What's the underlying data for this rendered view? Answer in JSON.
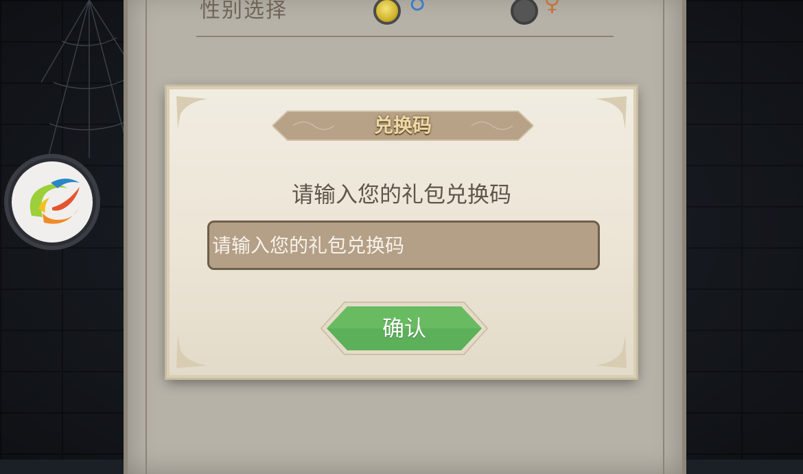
{
  "settings": {
    "gender_label": "性别选择",
    "male_symbol": "♂",
    "female_symbol": "♀",
    "selected_gender": "male"
  },
  "dialog": {
    "title": "兑换码",
    "prompt": "请输入您的礼包兑换码",
    "input_value": "",
    "input_placeholder": "请输入您的礼包兑换码",
    "confirm_label": "确认"
  },
  "colors": {
    "confirm_green": "#5cb05a",
    "banner_brown": "#b7a287",
    "input_bg": "#b49f87",
    "panel_bg": "#b7b2a8"
  }
}
